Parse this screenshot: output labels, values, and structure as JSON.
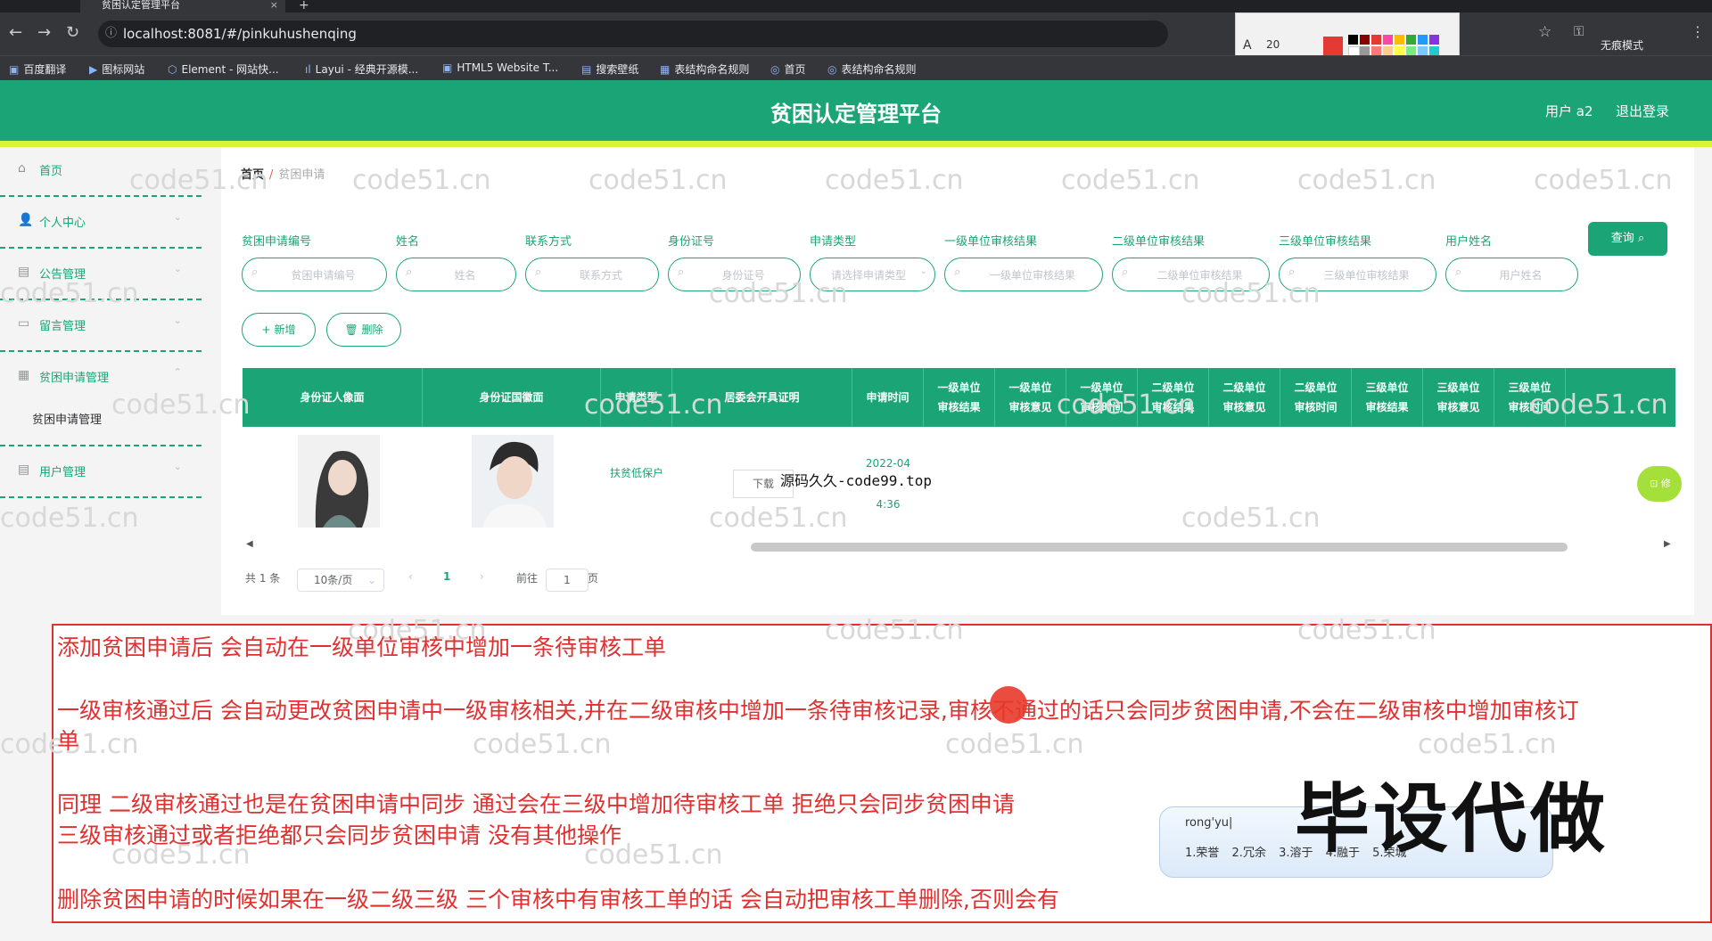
{
  "browser": {
    "tab_title": "贫困认定管理平台",
    "tab_close": "×",
    "new_tab": "+",
    "url": "localhost:8081/#/pinkuhushenqing",
    "incognito_label": "无痕模式",
    "bookmarks": [
      "百度翻译",
      "图标网站",
      "Element - 网站快...",
      "Layui - 经典开源模...",
      "HTML5 Website T...",
      "搜索壁纸",
      "表结构命名规则",
      "首页",
      "表结构命名规则"
    ],
    "font_size_value": "20"
  },
  "header": {
    "title": "贫困认定管理平台",
    "user": "用户 a2",
    "logout": "退出登录"
  },
  "sidebar": {
    "items": [
      {
        "label": "首页"
      },
      {
        "label": "个人中心"
      },
      {
        "label": "公告管理"
      },
      {
        "label": "留言管理"
      },
      {
        "label": "贫困申请管理"
      },
      {
        "label": "用户管理"
      }
    ],
    "sub_item": "贫困申请管理"
  },
  "breadcrumb": {
    "home": "首页",
    "sep": "/",
    "current": "贫困申请"
  },
  "filters": [
    {
      "label": "贫困申请编号",
      "placeholder": "贫困申请编号"
    },
    {
      "label": "姓名",
      "placeholder": "姓名"
    },
    {
      "label": "联系方式",
      "placeholder": "联系方式"
    },
    {
      "label": "身份证号",
      "placeholder": "身份证号"
    },
    {
      "label": "申请类型",
      "placeholder": "请选择申请类型"
    },
    {
      "label": "一级单位审核结果",
      "placeholder": "一级单位审核结果"
    },
    {
      "label": "二级单位审核结果",
      "placeholder": "二级单位审核结果"
    },
    {
      "label": "三级单位审核结果",
      "placeholder": "三级单位审核结果"
    },
    {
      "label": "用户姓名",
      "placeholder": "用户姓名"
    }
  ],
  "buttons": {
    "query": "查询",
    "add": "新增",
    "delete": "删除",
    "download": "下载",
    "operation": "修"
  },
  "table": {
    "headers": [
      "身份证人像面",
      "身份证国徽面",
      "申请类型",
      "居委会开具证明",
      "申请时间",
      "一级单位审核结果",
      "一级单位审核意见",
      "一级单位审核时间",
      "二级单位审核结果",
      "二级单位审核意见",
      "二级单位审核时间",
      "三级单位审核结果",
      "三级单位审核意见",
      "三级单位审核时间"
    ],
    "rows": [
      {
        "type": "扶贫低保户",
        "time_date": "2022-04",
        "time_clock": "4:36"
      }
    ]
  },
  "pagination": {
    "total": "共 1 条",
    "page_size": "10条/页",
    "prev": "‹",
    "current": "1",
    "next": "›",
    "goto": "前往",
    "goto_value": "1",
    "page_unit": "页"
  },
  "overlay_text": "源码久久-code99.top",
  "watermark": "code51.cn",
  "notes": [
    "添加贫困申请后  会自动在一级单位审核中增加一条待审核工单",
    "一级审核通过后 会自动更改贫困申请中一级审核相关,并在二级审核中增加一条待审核记录,审核不通过的话只会同步贫困申请,不会在二级审核中增加审核订",
    "单",
    "同理  二级审核通过也是在贫困申请中同步   通过会在三级中增加待审核工单   拒绝只会同步贫困申请",
    " 三级审核通过或者拒绝都只会同步贫困申请  没有其他操作",
    "删除贫困申请的时候如果在一级二级三级  三个审核中有审核工单的话 会自动把审核工单删除,否则会有"
  ],
  "ime": {
    "input": "rong'yu|",
    "candidates": "1.荣誉 2.冗余 3.溶于 4.融于 5.荣城"
  },
  "ad_text": "毕设代做",
  "colors": {
    "primary": "#1ba576",
    "accent_yellow": "#d9f23a",
    "note_red": "#e03030"
  }
}
